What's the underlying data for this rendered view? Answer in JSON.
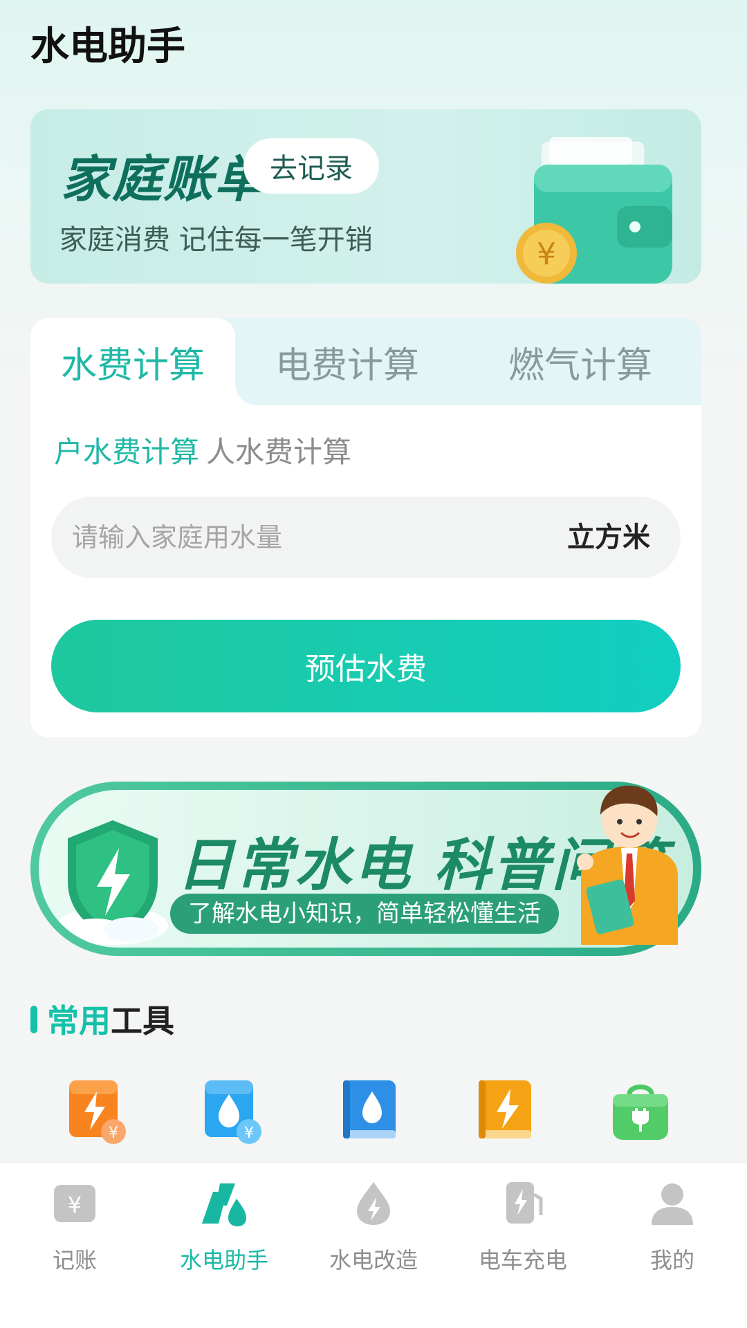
{
  "header": {
    "title": "水电助手"
  },
  "bill_card": {
    "title": "家庭账单",
    "button": "去记录",
    "subtitle": "家庭消费 记住每一笔开销"
  },
  "calculator": {
    "tabs": [
      "水费计算",
      "电费计算",
      "燃气计算"
    ],
    "active_tab": 0,
    "subtabs": [
      "户水费计算",
      "人水费计算"
    ],
    "input": {
      "placeholder": "请输入家庭用水量",
      "value": "",
      "unit": "立方米"
    },
    "submit": "预估水费"
  },
  "banner": {
    "title": "日常水电 科普问答",
    "subtitle": "了解水电小知识，简单轻松懂生活"
  },
  "tools": {
    "title_highlight": "常用",
    "title_rest": "工具",
    "items": [
      {
        "icon": "electricity-bill-icon"
      },
      {
        "icon": "water-bill-icon"
      },
      {
        "icon": "water-book-icon"
      },
      {
        "icon": "electricity-book-icon"
      },
      {
        "icon": "charger-bag-icon"
      }
    ]
  },
  "bottom_nav": {
    "items": [
      {
        "label": "记账",
        "icon": "bill-icon"
      },
      {
        "label": "水电助手",
        "icon": "assistant-icon"
      },
      {
        "label": "水电改造",
        "icon": "renovation-icon"
      },
      {
        "label": "电车充电",
        "icon": "ev-charging-icon"
      },
      {
        "label": "我的",
        "icon": "profile-icon"
      }
    ],
    "active": 1
  },
  "colors": {
    "accent": "#17b9a4",
    "button_gradient_start": "#1ec89d",
    "button_gradient_end": "#12cfc2",
    "bill_title": "#0f6f5d"
  }
}
